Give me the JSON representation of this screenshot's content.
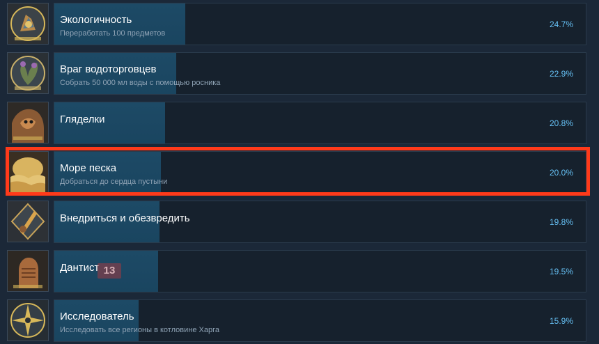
{
  "achievements": [
    {
      "name": "Экологичность",
      "desc": "Переработать 100 предметов",
      "percent": "24.7%",
      "percent_value": 24.7,
      "icon": "recycling-achievement-icon"
    },
    {
      "name": "Враг водоторговцев",
      "desc": "Собрать 50 000 мл воды с помощью росника",
      "percent": "22.9%",
      "percent_value": 22.9,
      "icon": "plant-achievement-icon"
    },
    {
      "name": "Гляделки",
      "desc": "",
      "percent": "20.8%",
      "percent_value": 20.8,
      "icon": "creature-achievement-icon"
    },
    {
      "name": "Море песка",
      "desc": "Добраться до сердца пустыни",
      "percent": "20.0%",
      "percent_value": 20.0,
      "icon": "desert-achievement-icon"
    },
    {
      "name": "Внедриться и обезвредить",
      "desc": "",
      "percent": "19.8%",
      "percent_value": 19.8,
      "icon": "dagger-achievement-icon"
    },
    {
      "name": "Дантист",
      "desc": "",
      "percent": "19.5%",
      "percent_value": 19.5,
      "icon": "fist-achievement-icon"
    },
    {
      "name": "Исследователь",
      "desc": "Исследовать все регионы в котловине Харга",
      "percent": "15.9%",
      "percent_value": 15.9,
      "icon": "compass-achievement-icon"
    }
  ],
  "watermark": "13",
  "colors": {
    "background": "#1b2838",
    "bar": "#1d4a66",
    "percent_text": "#66c0f4",
    "highlight": "#ff3a1a"
  }
}
